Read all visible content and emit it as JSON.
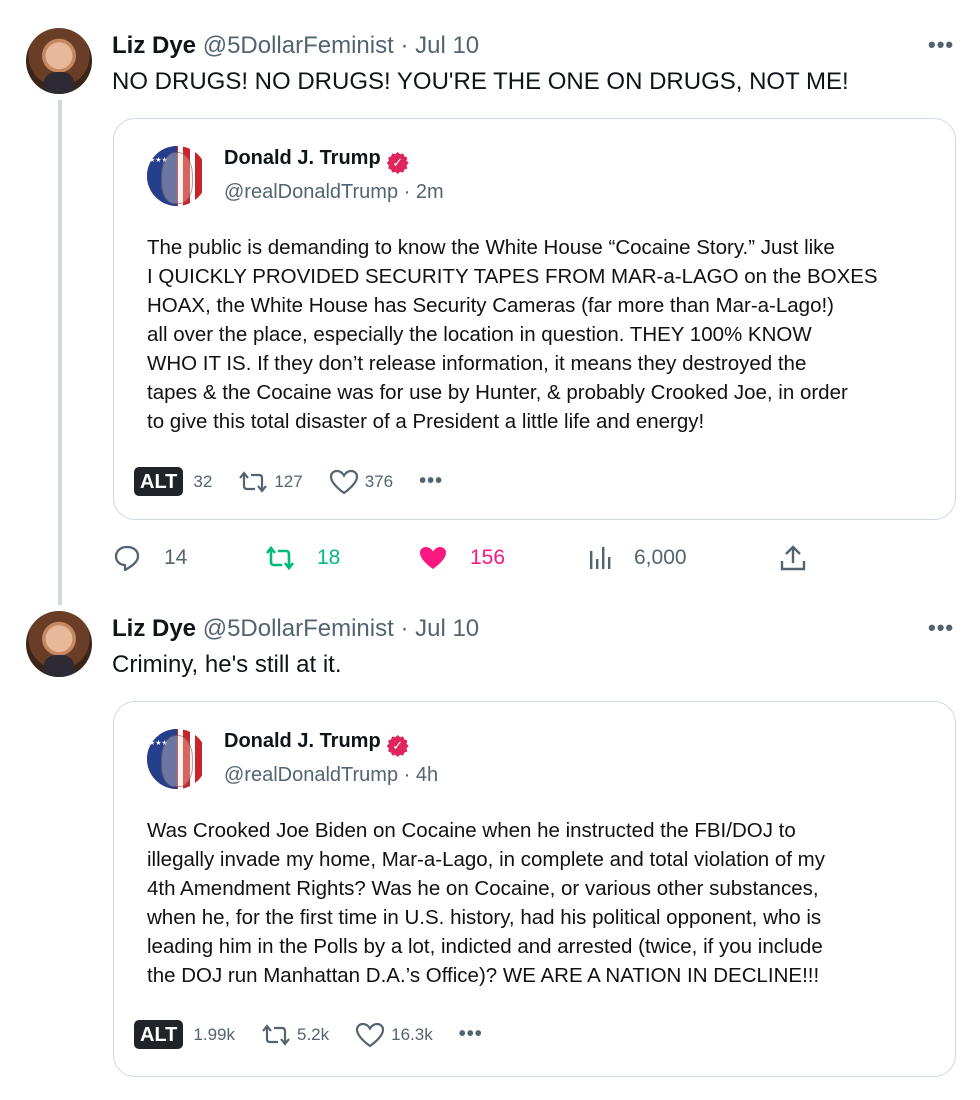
{
  "tweets": [
    {
      "author_name": "Liz Dye",
      "author_handle": "@5DollarFeminist",
      "date": "· Jul 10",
      "more": "•••",
      "text": "NO DRUGS! NO DRUGS! YOU'RE THE ONE ON DRUGS, NOT ME!",
      "quote": {
        "name": "Donald J. Trump",
        "handle": "@realDonaldTrump · 2m",
        "lines": [
          "The public is demanding to know the White House “Cocaine Story.” Just like",
          "I QUICKLY PROVIDED SECURITY TAPES FROM MAR-a-LAGO on the BOXES",
          "HOAX, the White House has Security Cameras (far more than Mar-a-Lago!)",
          "all over the place, especially the location in question. THEY 100% KNOW",
          "WHO IT IS. If they don’t release information, it means they destroyed the",
          "tapes & the Cocaine was for use by Hunter, & probably Crooked Joe, in order",
          "to give this total disaster of a President a little life and energy!"
        ],
        "alt": "ALT",
        "replies": "32",
        "retruths": "127",
        "likes": "376",
        "more": "•••"
      },
      "actions": {
        "replies": "14",
        "retweets": "18",
        "likes": "156",
        "views": "6,000"
      }
    },
    {
      "author_name": "Liz Dye",
      "author_handle": "@5DollarFeminist",
      "date": "· Jul 10",
      "more": "•••",
      "text": "Criminy, he's still at it.",
      "quote": {
        "name": "Donald J. Trump",
        "handle": "@realDonaldTrump · 4h",
        "lines": [
          "Was Crooked Joe Biden on Cocaine when he instructed the FBI/DOJ to",
          "illegally invade my home, Mar-a-Lago, in complete and total violation of  my",
          "4th Amendment Rights? Was he on Cocaine, or various other substances,",
          "when he, for the first time in U.S. history, had his political opponent, who is",
          "leading him in the Polls by a lot, indicted and arrested (twice, if you include",
          "the DOJ run Manhattan D.A.’s Office)? WE ARE A NATION IN DECLINE!!!"
        ],
        "alt": "ALT",
        "replies": "1.99k",
        "retruths": "5.2k",
        "likes": "16.3k",
        "more": "•••"
      }
    }
  ],
  "colors": {
    "text": "#0f1419",
    "muted": "#536471",
    "retweet_green": "#00ba7c",
    "like_pink": "#f91880",
    "border": "#cfd9de",
    "verified": "#e0245e"
  }
}
